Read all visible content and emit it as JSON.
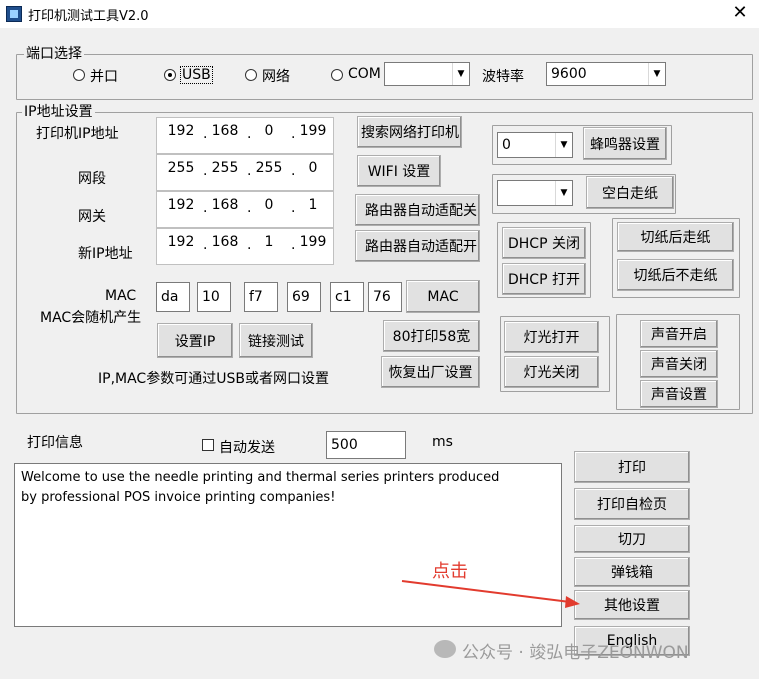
{
  "window": {
    "title": "打印机测试工具V2.0",
    "close": "✕"
  },
  "port": {
    "legend": "端口选择",
    "radios": [
      "并口",
      "USB",
      "网络",
      "COM"
    ],
    "selected": "USB",
    "com_value": "",
    "baud_label": "波特率",
    "baud_value": "9600"
  },
  "ip": {
    "legend": "IP地址设置",
    "printer_ip_label": "打印机IP地址",
    "subnet_label": "网段",
    "gateway_label": "网关",
    "new_ip_label": "新IP地址",
    "printer_ip": [
      "192",
      "168",
      "0",
      "199"
    ],
    "subnet": [
      "255",
      "255",
      "255",
      "0"
    ],
    "gateway": [
      "192",
      "168",
      "0",
      "1"
    ],
    "new_ip": [
      "192",
      "168",
      "1",
      "199"
    ],
    "search_btn": "搜索网络打印机",
    "wifi_btn": "WIFI 设置",
    "router_btn1": "路由器自动适配关",
    "router_btn2": "路由器自动适配开",
    "mac_label": "MAC",
    "mac_random_label": "MAC会随机产生",
    "mac": [
      "da",
      "10",
      "f7",
      "69",
      "c1",
      "76"
    ],
    "mac_btn": "MAC",
    "set_ip_btn": "设置IP",
    "link_test_btn": "链接测试",
    "print80_btn": "80打印58宽",
    "restore_btn": "恢复出厂设置",
    "hint": "IP,MAC参数可通过USB或者网口设置",
    "buzzer_value": "0",
    "buzzer_btn": "蜂鸣器设置",
    "blank_value": "",
    "blank_btn": "空白走纸",
    "dhcp_off": "DHCP 关闭",
    "dhcp_on": "DHCP 打开",
    "cut_feed": "切纸后走纸",
    "cut_nofeed": "切纸后不走纸",
    "light_on": "灯光打开",
    "light_off": "灯光关闭",
    "sound_on": "声音开启",
    "sound_off": "声音关闭",
    "sound_set": "声音设置"
  },
  "print_info": {
    "label": "打印信息",
    "auto_send": "自动发送",
    "interval": "500",
    "unit": "ms",
    "text_line1": "Welcome to use the needle printing and thermal series printers produced",
    "text_line2": "by professional POS invoice printing companies!"
  },
  "actions": {
    "print": "打印",
    "self_test": "打印自检页",
    "cutter": "切刀",
    "cash_drawer": "弹钱箱",
    "other": "其他设置",
    "english": "English"
  },
  "annotation": {
    "click": "点击",
    "color": "#e23b2e"
  },
  "watermark": {
    "text": "公众号 · 竣弘电子ZEONWON"
  }
}
